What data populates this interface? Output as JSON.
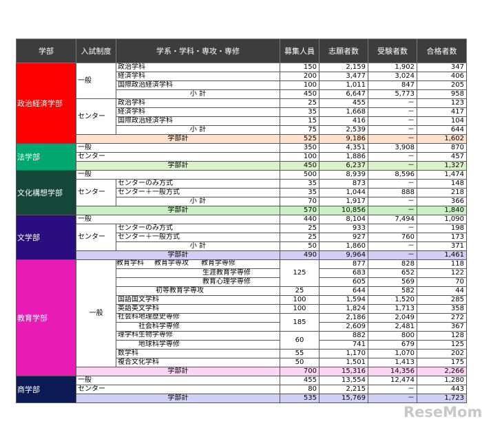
{
  "headers": [
    "学部",
    "入試制度",
    "学系・学科・専攻・専修",
    "募集人員",
    "志願者数",
    "受験者数",
    "合格者数"
  ],
  "faculties": [
    "政治経済学部",
    "法学部",
    "文化構想学部",
    "文学部",
    "教育学部",
    "商学部"
  ],
  "pol": {
    "ippan": "一般",
    "center": "センター",
    "shokei": "小 計",
    "gakubukei": "学部計",
    "r1": {
      "name": "政治学科",
      "a": "150",
      "b": "2,159",
      "c": "1,902",
      "d": "347"
    },
    "r2": {
      "name": "経済学科",
      "a": "200",
      "b": "3,477",
      "c": "3,024",
      "d": "406"
    },
    "r3": {
      "name": "国際政治経済学科",
      "a": "100",
      "b": "1,011",
      "c": "847",
      "d": "205"
    },
    "r4": {
      "a": "450",
      "b": "6,647",
      "c": "5,773",
      "d": "958"
    },
    "r5": {
      "name": "政治学科",
      "a": "25",
      "b": "455",
      "c": "－",
      "d": "123"
    },
    "r6": {
      "name": "経済学科",
      "a": "35",
      "b": "1,668",
      "c": "－",
      "d": "417"
    },
    "r7": {
      "name": "国際政治経済学科",
      "a": "15",
      "b": "416",
      "c": "－",
      "d": "104"
    },
    "r8": {
      "a": "75",
      "b": "2,539",
      "c": "－",
      "d": "644"
    },
    "r9": {
      "a": "525",
      "b": "9,186",
      "c": "－",
      "d": "1,602"
    }
  },
  "law": {
    "ippan": "一般",
    "center": "センター",
    "gakubukei": "学部計",
    "r1": {
      "a": "350",
      "b": "4,351",
      "c": "3,908",
      "d": "870"
    },
    "r2": {
      "a": "100",
      "b": "1,886",
      "c": "－",
      "d": "457"
    },
    "r3": {
      "a": "450",
      "b": "6,237",
      "c": "－",
      "d": "1,327"
    }
  },
  "cul": {
    "ippan": "一般",
    "center": "センター",
    "shokei": "小 計",
    "gakubukei": "学部計",
    "r1": {
      "a": "500",
      "b": "8,939",
      "c": "8,596",
      "d": "1,474"
    },
    "r2": {
      "name": "センターのみ方式",
      "a": "35",
      "b": "873",
      "c": "－",
      "d": "148"
    },
    "r3": {
      "name": "センター＋一般方式",
      "a": "35",
      "b": "1,044",
      "c": "888",
      "d": "218"
    },
    "r4": {
      "a": "70",
      "b": "1,917",
      "c": "－",
      "d": "366"
    },
    "r5": {
      "a": "570",
      "b": "10,856",
      "c": "－",
      "d": "1,840"
    }
  },
  "let": {
    "ippan": "一般",
    "center": "センター",
    "shokei": "小 計",
    "gakubukei": "学部計",
    "r1": {
      "a": "440",
      "b": "8,104",
      "c": "7,494",
      "d": "1,090"
    },
    "r2": {
      "name": "センターのみ方式",
      "a": "25",
      "b": "933",
      "c": "－",
      "d": "198"
    },
    "r3": {
      "name": "センター＋一般方式",
      "a": "25",
      "b": "927",
      "c": "760",
      "d": "173"
    },
    "r4": {
      "a": "50",
      "b": "1,860",
      "c": "－",
      "d": "371"
    },
    "r5": {
      "a": "490",
      "b": "9,964",
      "c": "－",
      "d": "1,461"
    }
  },
  "edu": {
    "ippan": "一般",
    "gakubukei": "学部計",
    "kyoiku": "教育学科",
    "kyoikugaku": "教育学専攻",
    "shakai": "社会科",
    "rika": "理学科",
    "kyoiku_a": "125",
    "shakai_a": "185",
    "rika_a": "60",
    "r1": {
      "name": "教育学専修",
      "b": "877",
      "c": "828",
      "d": "118"
    },
    "r2": {
      "name": "生涯教育学専修",
      "b": "683",
      "c": "652",
      "d": "122"
    },
    "r3": {
      "name": "教育心理学専修",
      "b": "605",
      "c": "569",
      "d": "70"
    },
    "r4": {
      "name": "初等教育学専攻",
      "a": "25",
      "b": "644",
      "c": "582",
      "d": "44"
    },
    "r5": {
      "name": "国語国文学科",
      "a": "100",
      "b": "1,594",
      "c": "1,520",
      "d": "285"
    },
    "r6": {
      "name": "英語英文学科",
      "a": "100",
      "b": "1,824",
      "c": "1,713",
      "d": "358"
    },
    "r7": {
      "name": "地理歴史専修",
      "b": "2,186",
      "c": "2,049",
      "d": "272"
    },
    "r8": {
      "name": "社会科学専修",
      "b": "2,609",
      "c": "2,481",
      "d": "367"
    },
    "r9": {
      "name": "生物学専修",
      "b": "882",
      "c": "800",
      "d": "128"
    },
    "r10": {
      "name": "地球科学専修",
      "b": "741",
      "c": "679",
      "d": "125"
    },
    "r11": {
      "name": "数学科",
      "a": "55",
      "b": "1,170",
      "c": "1,070",
      "d": "202"
    },
    "r12": {
      "name": "複合文化学科",
      "a": "50",
      "b": "1,501",
      "c": "1,413",
      "d": "175"
    },
    "r13": {
      "a": "700",
      "b": "15,316",
      "c": "14,356",
      "d": "2,266"
    }
  },
  "com": {
    "ippan": "一般",
    "center": "センター",
    "gakubukei": "学部計",
    "r1": {
      "a": "455",
      "b": "13,554",
      "c": "12,474",
      "d": "1,280"
    },
    "r2": {
      "a": "80",
      "b": "2,215",
      "c": "－",
      "d": "443"
    },
    "r3": {
      "a": "535",
      "b": "15,769",
      "c": "－",
      "d": "1,723"
    }
  },
  "logo": "ReseMom"
}
